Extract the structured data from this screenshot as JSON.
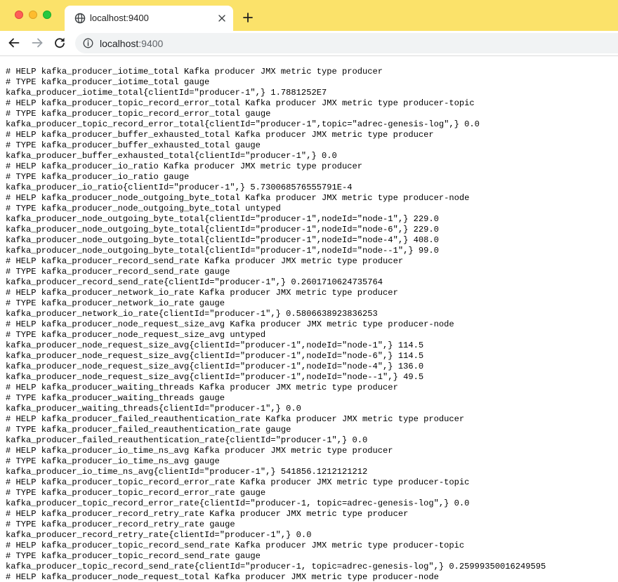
{
  "browser": {
    "tab": {
      "title": "localhost:9400",
      "favicon": "globe-icon"
    },
    "address": {
      "host": "localhost",
      "port": ":9400"
    },
    "colors": {
      "tabstrip": "#fbe26a",
      "close": "#fe5f57",
      "minimize": "#febc2e",
      "maximize": "#28c840"
    }
  },
  "page": {
    "lines": [
      "# HELP kafka_producer_iotime_total Kafka producer JMX metric type producer",
      "# TYPE kafka_producer_iotime_total gauge",
      "kafka_producer_iotime_total{clientId=\"producer-1\",} 1.7881252E7",
      "# HELP kafka_producer_topic_record_error_total Kafka producer JMX metric type producer-topic",
      "# TYPE kafka_producer_topic_record_error_total gauge",
      "kafka_producer_topic_record_error_total{clientId=\"producer-1\",topic=\"adrec-genesis-log\",} 0.0",
      "# HELP kafka_producer_buffer_exhausted_total Kafka producer JMX metric type producer",
      "# TYPE kafka_producer_buffer_exhausted_total gauge",
      "kafka_producer_buffer_exhausted_total{clientId=\"producer-1\",} 0.0",
      "# HELP kafka_producer_io_ratio Kafka producer JMX metric type producer",
      "# TYPE kafka_producer_io_ratio gauge",
      "kafka_producer_io_ratio{clientId=\"producer-1\",} 5.730068576555791E-4",
      "# HELP kafka_producer_node_outgoing_byte_total Kafka producer JMX metric type producer-node",
      "# TYPE kafka_producer_node_outgoing_byte_total untyped",
      "kafka_producer_node_outgoing_byte_total{clientId=\"producer-1\",nodeId=\"node-1\",} 229.0",
      "kafka_producer_node_outgoing_byte_total{clientId=\"producer-1\",nodeId=\"node-6\",} 229.0",
      "kafka_producer_node_outgoing_byte_total{clientId=\"producer-1\",nodeId=\"node-4\",} 408.0",
      "kafka_producer_node_outgoing_byte_total{clientId=\"producer-1\",nodeId=\"node--1\",} 99.0",
      "# HELP kafka_producer_record_send_rate Kafka producer JMX metric type producer",
      "# TYPE kafka_producer_record_send_rate gauge",
      "kafka_producer_record_send_rate{clientId=\"producer-1\",} 0.2601710624735764",
      "# HELP kafka_producer_network_io_rate Kafka producer JMX metric type producer",
      "# TYPE kafka_producer_network_io_rate gauge",
      "kafka_producer_network_io_rate{clientId=\"producer-1\",} 0.5806638923836253",
      "# HELP kafka_producer_node_request_size_avg Kafka producer JMX metric type producer-node",
      "# TYPE kafka_producer_node_request_size_avg untyped",
      "kafka_producer_node_request_size_avg{clientId=\"producer-1\",nodeId=\"node-1\",} 114.5",
      "kafka_producer_node_request_size_avg{clientId=\"producer-1\",nodeId=\"node-6\",} 114.5",
      "kafka_producer_node_request_size_avg{clientId=\"producer-1\",nodeId=\"node-4\",} 136.0",
      "kafka_producer_node_request_size_avg{clientId=\"producer-1\",nodeId=\"node--1\",} 49.5",
      "# HELP kafka_producer_waiting_threads Kafka producer JMX metric type producer",
      "# TYPE kafka_producer_waiting_threads gauge",
      "kafka_producer_waiting_threads{clientId=\"producer-1\",} 0.0",
      "# HELP kafka_producer_failed_reauthentication_rate Kafka producer JMX metric type producer",
      "# TYPE kafka_producer_failed_reauthentication_rate gauge",
      "kafka_producer_failed_reauthentication_rate{clientId=\"producer-1\",} 0.0",
      "# HELP kafka_producer_io_time_ns_avg Kafka producer JMX metric type producer",
      "# TYPE kafka_producer_io_time_ns_avg gauge",
      "kafka_producer_io_time_ns_avg{clientId=\"producer-1\",} 541856.1212121212",
      "# HELP kafka_producer_topic_record_error_rate Kafka producer JMX metric type producer-topic",
      "# TYPE kafka_producer_topic_record_error_rate gauge",
      "kafka_producer_topic_record_error_rate{clientId=\"producer-1, topic=adrec-genesis-log\",} 0.0",
      "# HELP kafka_producer_record_retry_rate Kafka producer JMX metric type producer",
      "# TYPE kafka_producer_record_retry_rate gauge",
      "kafka_producer_record_retry_rate{clientId=\"producer-1\",} 0.0",
      "# HELP kafka_producer_topic_record_send_rate Kafka producer JMX metric type producer-topic",
      "# TYPE kafka_producer_topic_record_send_rate gauge",
      "kafka_producer_topic_record_send_rate{clientId=\"producer-1, topic=adrec-genesis-log\",} 0.25999350016249595",
      "# HELP kafka_producer_node_request_total Kafka producer JMX metric type producer-node"
    ]
  }
}
